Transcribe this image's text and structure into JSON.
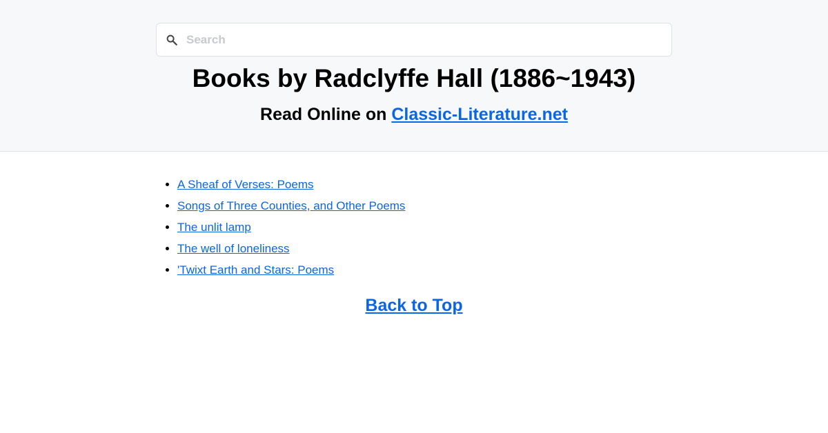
{
  "search": {
    "placeholder": "Search",
    "value": "",
    "icon": "search-icon"
  },
  "header": {
    "title": "Books by Radclyffe Hall (1886~1943)",
    "subtitle_prefix": "Read Online on ",
    "site_link_label": "Classic-Literature.net"
  },
  "books": [
    "A Sheaf of Verses: Poems",
    "Songs of Three Counties, and Other Poems",
    "The unlit lamp",
    "The well of loneliness",
    "'Twixt Earth and Stars: Poems"
  ],
  "footer": {
    "back_to_top_label": "Back to Top"
  },
  "colors": {
    "link": "#0a66e4",
    "header_bg": "#f7f8fa"
  }
}
